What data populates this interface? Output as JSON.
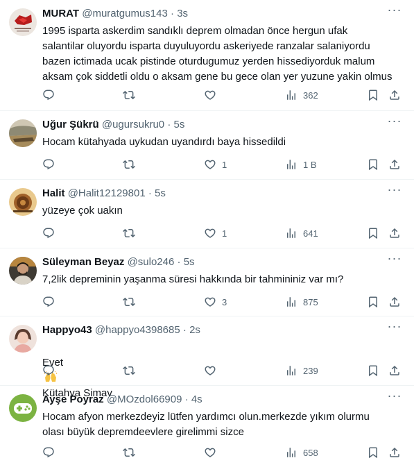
{
  "icons": {
    "reply": "reply-icon",
    "retweet": "retweet-icon",
    "like": "like-icon",
    "views": "views-icon",
    "bookmark": "bookmark-icon",
    "share": "share-icon",
    "more": "more-icon"
  },
  "colors": {
    "text": "#0f1419",
    "secondary": "#536471",
    "divider": "#eff3f4"
  },
  "ui": {
    "more_glyph": "···",
    "separator": "·"
  },
  "tweets": [
    {
      "name": "MURAT",
      "handle": "@muratgumus143",
      "time": "3s",
      "text": "1995 isparta askerdim sandıklı deprem olmadan önce hergun ufak\nsalantilar oluyordu isparta duyuluyordu askeriyede ranzalar salaniyordu\nbazen ictimada ucak pistinde oturdugumuz yerden hissediyorduk malum\naksam çok siddetli oldu o aksam gene bu gece olan yer yuzune yakin olmus",
      "likes": "",
      "views": "362"
    },
    {
      "name": "Uğur Şükrü",
      "handle": "@ugursukru0",
      "time": "5s",
      "text": "Hocam kütahyada uykudan uyandırdı baya hissedildi",
      "likes": "1",
      "views": "1 B"
    },
    {
      "name": "Halit",
      "handle": "@Halit12129801",
      "time": "5s",
      "text": "yüzeye çok uakın",
      "likes": "1",
      "views": "641"
    },
    {
      "name": "Süleyman Beyaz",
      "handle": "@sulo246",
      "time": "5s",
      "text": "7,2lik depreminin yaşanma süresi hakkında bir tahmininiz var mı?",
      "likes": "3",
      "views": "875"
    },
    {
      "name": "Happyo43",
      "handle": "@happyo4398685",
      "time": "2s",
      "text_before": "Evet",
      "text_after": "Kütahya Simav",
      "likes": "",
      "views": "239"
    },
    {
      "name": "Ayşe Poyraz",
      "handle": "@MOzdol66909",
      "time": "4s",
      "text": "Hocam afyon merkezdeyiz lütfen yardımcı olun.merkezde yıkım olurmu\nolası büyük depremdeevlere girelimmi sizce",
      "likes": "",
      "views": "658"
    }
  ]
}
